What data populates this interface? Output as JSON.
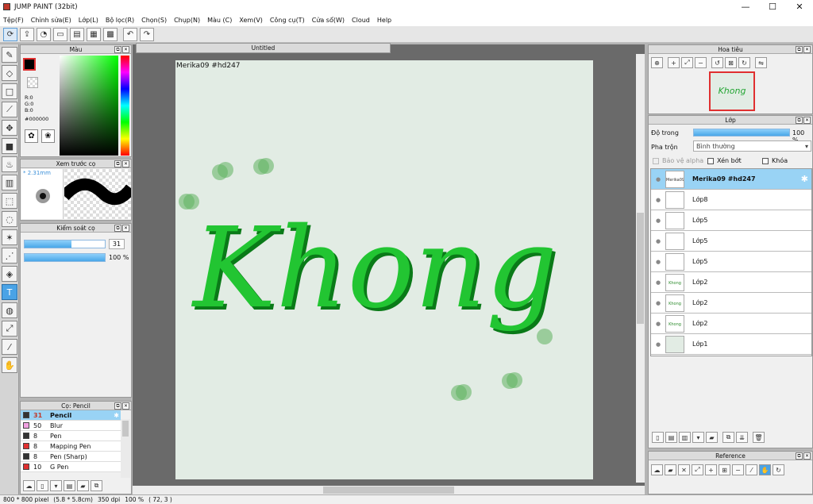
{
  "window": {
    "title": "JUMP PAINT (32bit)",
    "minimize": "—",
    "maximize": "☐",
    "close": "✕"
  },
  "menu": [
    "Tệp(F)",
    "Chỉnh sửa(E)",
    "Lớp(L)",
    "Bộ lọc(R)",
    "Chọn(S)",
    "Chụp(N)",
    "Màu (C)",
    "Xem(V)",
    "Công cụ(T)",
    "Cửa sổ(W)",
    "Cloud",
    "Help"
  ],
  "toolbar_icons": [
    "brush-sync-icon",
    "export-icon",
    "comment-icon",
    "chat-icon",
    "page-icon",
    "layout-icon",
    "grid-icon",
    "undo-icon",
    "redo-icon"
  ],
  "color_panel": {
    "title": "Màu",
    "r": "R:0",
    "g": "G:0",
    "b": "B:0",
    "hex": "#000000"
  },
  "brush_preview": {
    "title": "Xem trước cọ",
    "size": "* 2.31mm"
  },
  "brush_control": {
    "title": "Kiểm soát cọ",
    "size_value": "31",
    "opacity_value": "100 %",
    "size_fraction": 0.58,
    "opacity_fraction": 1.0
  },
  "brush_list": {
    "title": "Cọ: Pencil",
    "items": [
      {
        "size": "31",
        "name": "Pencil",
        "color": "#333333"
      },
      {
        "size": "50",
        "name": "Blur",
        "color": "#f0a0e0"
      },
      {
        "size": "8",
        "name": "Pen",
        "color": "#333333"
      },
      {
        "size": "8",
        "name": "Mapping Pen",
        "color": "#e03030"
      },
      {
        "size": "8",
        "name": "Pen (Sharp)",
        "color": "#333333"
      },
      {
        "size": "10",
        "name": "G Pen",
        "color": "#e03030"
      }
    ]
  },
  "document": {
    "tab": "Untitled",
    "signature": "Merika09  #hd247",
    "artwork_text": "Khong ^^"
  },
  "navigator": {
    "title": "Hoa tiêu",
    "thumb_text": "Khong"
  },
  "layer_panel": {
    "title": "Lớp",
    "opacity_label": "Độ trong",
    "opacity_value": "100 %",
    "blend_label": "Pha trộn",
    "blend_value": "Bình thường",
    "protect_alpha": "Bảo vệ alpha",
    "clipping": "Xén bớt",
    "lock": "Khóa",
    "layers": [
      {
        "name": "Merika09  #hd247",
        "thumb": "Merika09 #hd247",
        "selected": true
      },
      {
        "name": "Lớp8",
        "thumb": ""
      },
      {
        "name": "Lớp5",
        "thumb": ""
      },
      {
        "name": "Lớp5",
        "thumb": ""
      },
      {
        "name": "Lớp5",
        "thumb": ""
      },
      {
        "name": "Lớp2",
        "thumb": "Khong"
      },
      {
        "name": "Lớp2",
        "thumb": "Khong"
      },
      {
        "name": "Lớp2",
        "thumb": "Khong"
      },
      {
        "name": "Lớp1",
        "thumb": ""
      }
    ]
  },
  "reference": {
    "title": "Reference"
  },
  "status": {
    "pixels": "800 * 800 pixel",
    "size": "(5.8 * 5.8cm)",
    "dpi": "350 dpi",
    "zoom": "100 %",
    "coords": "( 72, 3 )"
  },
  "colors": {
    "accent": "#4aa3e6",
    "selected_row": "#99d3f5",
    "canvas_bg": "#e2ece4",
    "stroke_green": "#1fb82c"
  }
}
